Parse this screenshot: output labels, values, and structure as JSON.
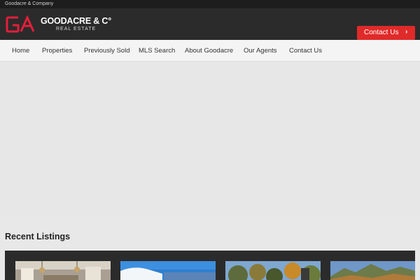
{
  "topbar": {
    "company": "Goodacre & Company"
  },
  "header": {
    "logo_name": "GOODACRE & C°",
    "logo_sub": "REAL ESTATE",
    "contact_button": "Contact Us",
    "contact_arrow": "›"
  },
  "nav": {
    "items": [
      {
        "label": "Home"
      },
      {
        "label": "Properties"
      },
      {
        "label": "Previously Sold"
      },
      {
        "label": "MLS Search"
      },
      {
        "label": "About Goodacre"
      },
      {
        "label": "Our Agents"
      },
      {
        "label": "Contact Us"
      }
    ]
  },
  "main": {
    "section_title": "Recent Listings"
  },
  "colors": {
    "accent": "#e02a2a",
    "header_bg": "#2b2b2b",
    "topbar_bg": "#1d1d1d",
    "nav_bg": "#f4f4f4"
  },
  "icons": {
    "cta_arrow": "chevron-right-icon",
    "logo": "ga-monogram-logo"
  }
}
